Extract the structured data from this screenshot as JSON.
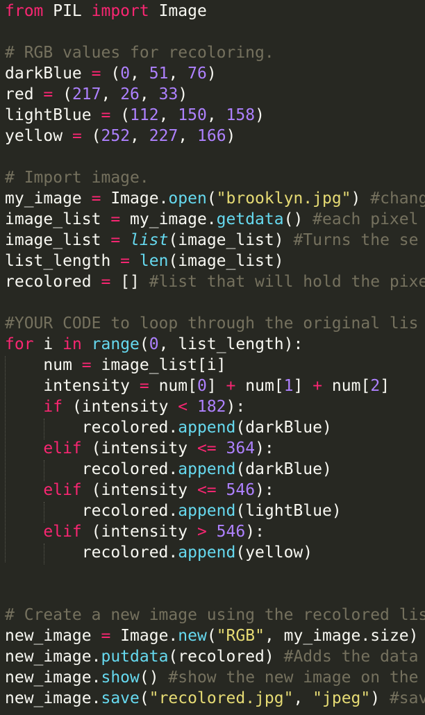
{
  "colors": {
    "background": "#272822",
    "text": "#F8F8F2",
    "keyword": "#F92672",
    "function": "#66D9EF",
    "number": "#AE81FF",
    "string": "#E6DB74",
    "comment": "#75715E"
  },
  "code": {
    "lines": [
      [
        {
          "t": "from",
          "c": "kw"
        },
        {
          "t": " PIL "
        },
        {
          "t": "import",
          "c": "kw"
        },
        {
          "t": " Image"
        }
      ],
      [],
      [
        {
          "t": "# RGB values for recoloring.",
          "c": "cm"
        }
      ],
      [
        {
          "t": "darkBlue "
        },
        {
          "t": "=",
          "c": "op"
        },
        {
          "t": " ("
        },
        {
          "t": "0",
          "c": "num"
        },
        {
          "t": ", "
        },
        {
          "t": "51",
          "c": "num"
        },
        {
          "t": ", "
        },
        {
          "t": "76",
          "c": "num"
        },
        {
          "t": ")"
        }
      ],
      [
        {
          "t": "red "
        },
        {
          "t": "=",
          "c": "op"
        },
        {
          "t": " ("
        },
        {
          "t": "217",
          "c": "num"
        },
        {
          "t": ", "
        },
        {
          "t": "26",
          "c": "num"
        },
        {
          "t": ", "
        },
        {
          "t": "33",
          "c": "num"
        },
        {
          "t": ")"
        }
      ],
      [
        {
          "t": "lightBlue "
        },
        {
          "t": "=",
          "c": "op"
        },
        {
          "t": " ("
        },
        {
          "t": "112",
          "c": "num"
        },
        {
          "t": ", "
        },
        {
          "t": "150",
          "c": "num"
        },
        {
          "t": ", "
        },
        {
          "t": "158",
          "c": "num"
        },
        {
          "t": ")"
        }
      ],
      [
        {
          "t": "yellow "
        },
        {
          "t": "=",
          "c": "op"
        },
        {
          "t": " ("
        },
        {
          "t": "252",
          "c": "num"
        },
        {
          "t": ", "
        },
        {
          "t": "227",
          "c": "num"
        },
        {
          "t": ", "
        },
        {
          "t": "166",
          "c": "num"
        },
        {
          "t": ")"
        }
      ],
      [],
      [
        {
          "t": "# Import image.",
          "c": "cm"
        }
      ],
      [
        {
          "t": "my_image "
        },
        {
          "t": "=",
          "c": "op"
        },
        {
          "t": " Image."
        },
        {
          "t": "open",
          "c": "fn"
        },
        {
          "t": "("
        },
        {
          "t": "\"brooklyn.jpg\"",
          "c": "str"
        },
        {
          "t": ") "
        },
        {
          "t": "#chang",
          "c": "cm"
        }
      ],
      [
        {
          "t": "image_list "
        },
        {
          "t": "=",
          "c": "op"
        },
        {
          "t": " my_image."
        },
        {
          "t": "getdata",
          "c": "fn"
        },
        {
          "t": "() "
        },
        {
          "t": "#each pixel",
          "c": "cm"
        }
      ],
      [
        {
          "t": "image_list "
        },
        {
          "t": "=",
          "c": "op"
        },
        {
          "t": " "
        },
        {
          "t": "list",
          "c": "bi"
        },
        {
          "t": "(image_list) "
        },
        {
          "t": "#Turns the se",
          "c": "cm"
        }
      ],
      [
        {
          "t": "list_length "
        },
        {
          "t": "=",
          "c": "op"
        },
        {
          "t": " "
        },
        {
          "t": "len",
          "c": "fn"
        },
        {
          "t": "(image_list)"
        }
      ],
      [
        {
          "t": "recolored "
        },
        {
          "t": "=",
          "c": "op"
        },
        {
          "t": " [] "
        },
        {
          "t": "#list that will hold the pixe",
          "c": "cm"
        }
      ],
      [],
      [
        {
          "t": "#YOUR CODE to loop through the original lis",
          "c": "cm"
        }
      ],
      [
        {
          "t": "for",
          "c": "kw"
        },
        {
          "t": " i "
        },
        {
          "t": "in",
          "c": "kw"
        },
        {
          "t": " "
        },
        {
          "t": "range",
          "c": "fn"
        },
        {
          "t": "("
        },
        {
          "t": "0",
          "c": "num"
        },
        {
          "t": ", list_length):"
        }
      ],
      [
        {
          "t": "    num "
        },
        {
          "t": "=",
          "c": "op"
        },
        {
          "t": " image_list[i]"
        }
      ],
      [
        {
          "t": "    intensity "
        },
        {
          "t": "=",
          "c": "op"
        },
        {
          "t": " num["
        },
        {
          "t": "0",
          "c": "num"
        },
        {
          "t": "] "
        },
        {
          "t": "+",
          "c": "op"
        },
        {
          "t": " num["
        },
        {
          "t": "1",
          "c": "num"
        },
        {
          "t": "] "
        },
        {
          "t": "+",
          "c": "op"
        },
        {
          "t": " num["
        },
        {
          "t": "2",
          "c": "num"
        },
        {
          "t": "]"
        }
      ],
      [
        {
          "t": "    "
        },
        {
          "t": "if",
          "c": "kw"
        },
        {
          "t": " (intensity "
        },
        {
          "t": "<",
          "c": "op"
        },
        {
          "t": " "
        },
        {
          "t": "182",
          "c": "num"
        },
        {
          "t": "):"
        }
      ],
      [
        {
          "t": "        recolored."
        },
        {
          "t": "append",
          "c": "fn"
        },
        {
          "t": "(darkBlue)"
        }
      ],
      [
        {
          "t": "    "
        },
        {
          "t": "elif",
          "c": "kw"
        },
        {
          "t": " (intensity "
        },
        {
          "t": "<=",
          "c": "op"
        },
        {
          "t": " "
        },
        {
          "t": "364",
          "c": "num"
        },
        {
          "t": "):"
        }
      ],
      [
        {
          "t": "        recolored."
        },
        {
          "t": "append",
          "c": "fn"
        },
        {
          "t": "(darkBlue)"
        }
      ],
      [
        {
          "t": "    "
        },
        {
          "t": "elif",
          "c": "kw"
        },
        {
          "t": " (intensity "
        },
        {
          "t": "<=",
          "c": "op"
        },
        {
          "t": " "
        },
        {
          "t": "546",
          "c": "num"
        },
        {
          "t": "):"
        }
      ],
      [
        {
          "t": "        recolored."
        },
        {
          "t": "append",
          "c": "fn"
        },
        {
          "t": "(lightBlue)"
        }
      ],
      [
        {
          "t": "    "
        },
        {
          "t": "elif",
          "c": "kw"
        },
        {
          "t": " (intensity "
        },
        {
          "t": ">",
          "c": "op"
        },
        {
          "t": " "
        },
        {
          "t": "546",
          "c": "num"
        },
        {
          "t": "):"
        }
      ],
      [
        {
          "t": "        recolored."
        },
        {
          "t": "append",
          "c": "fn"
        },
        {
          "t": "(yellow)"
        }
      ],
      [],
      [],
      [
        {
          "t": "# Create a new image using the recolored lis",
          "c": "cm"
        }
      ],
      [
        {
          "t": "new_image "
        },
        {
          "t": "=",
          "c": "op"
        },
        {
          "t": " Image."
        },
        {
          "t": "new",
          "c": "fn"
        },
        {
          "t": "("
        },
        {
          "t": "\"RGB\"",
          "c": "str"
        },
        {
          "t": ", my_image.size)"
        }
      ],
      [
        {
          "t": "new_image."
        },
        {
          "t": "putdata",
          "c": "fn"
        },
        {
          "t": "(recolored) "
        },
        {
          "t": "#Adds the data",
          "c": "cm"
        }
      ],
      [
        {
          "t": "new_image."
        },
        {
          "t": "show",
          "c": "fn"
        },
        {
          "t": "() "
        },
        {
          "t": "#show the new image on the",
          "c": "cm"
        }
      ],
      [
        {
          "t": "new_image."
        },
        {
          "t": "save",
          "c": "fn"
        },
        {
          "t": "("
        },
        {
          "t": "\"recolored.jpg\"",
          "c": "str"
        },
        {
          "t": ", "
        },
        {
          "t": "\"jpeg\"",
          "c": "str"
        },
        {
          "t": ") "
        },
        {
          "t": "#sav",
          "c": "cm"
        }
      ]
    ]
  }
}
